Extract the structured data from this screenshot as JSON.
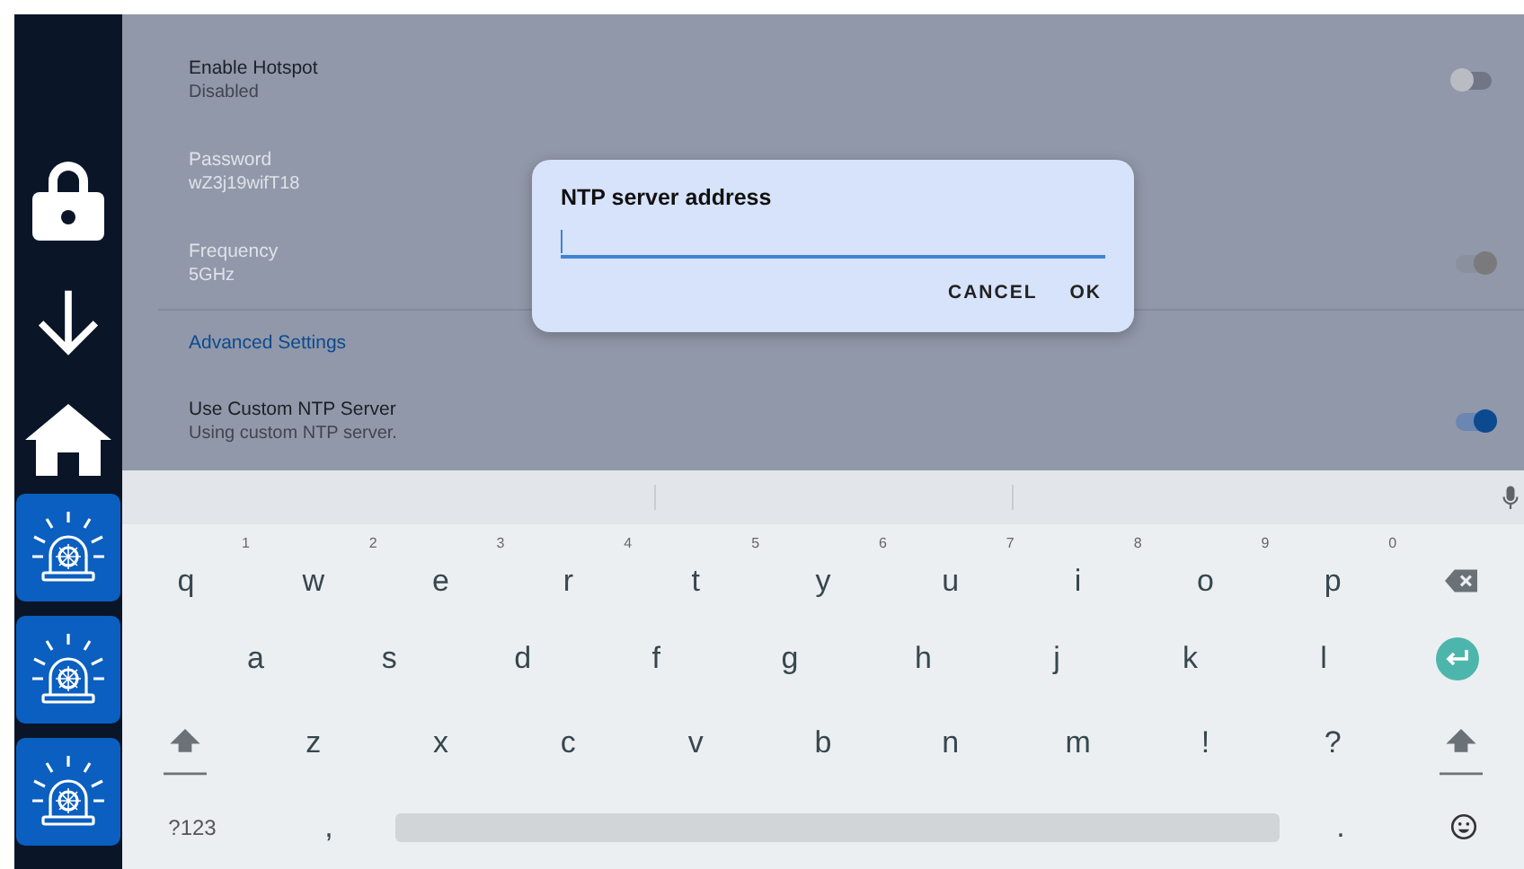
{
  "sidebar": [
    {
      "kind": "lock"
    },
    {
      "kind": "arrow"
    },
    {
      "kind": "home"
    },
    {
      "kind": "siren"
    },
    {
      "kind": "siren"
    },
    {
      "kind": "siren"
    }
  ],
  "settings": [
    {
      "kind": "toggle",
      "label": "Enable Hotspot",
      "value": "Disabled",
      "on": false,
      "disabled": false
    },
    {
      "kind": "text",
      "label": "Password",
      "value": "wZ3j19wifT18",
      "disabled": true
    },
    {
      "kind": "toggle",
      "label": "Frequency",
      "value": "5GHz",
      "on": true,
      "disabled": true
    },
    {
      "kind": "header",
      "label": "Advanced Settings"
    },
    {
      "kind": "toggle",
      "label": "Use Custom NTP Server",
      "value": "Using custom NTP server.",
      "on": true,
      "disabled": false
    }
  ],
  "dialog": {
    "title": "NTP server address",
    "buttons": [
      "CANCEL",
      "OK"
    ]
  },
  "keyboard": {
    "rows": [
      [
        {
          "kind": "char",
          "label": "q",
          "hint": "1"
        },
        {
          "kind": "char",
          "label": "w",
          "hint": "2"
        },
        {
          "kind": "char",
          "label": "e",
          "hint": "3"
        },
        {
          "kind": "char",
          "label": "r",
          "hint": "4"
        },
        {
          "kind": "char",
          "label": "t",
          "hint": "5"
        },
        {
          "kind": "char",
          "label": "y",
          "hint": "6"
        },
        {
          "kind": "char",
          "label": "u",
          "hint": "7"
        },
        {
          "kind": "char",
          "label": "i",
          "hint": "8"
        },
        {
          "kind": "char",
          "label": "o",
          "hint": "9"
        },
        {
          "kind": "char",
          "label": "p",
          "hint": "0"
        },
        {
          "kind": "backspace"
        }
      ],
      [
        {
          "kind": "gap"
        },
        {
          "kind": "char",
          "label": "a"
        },
        {
          "kind": "char",
          "label": "s"
        },
        {
          "kind": "char",
          "label": "d"
        },
        {
          "kind": "char",
          "label": "f"
        },
        {
          "kind": "char",
          "label": "g"
        },
        {
          "kind": "char",
          "label": "h"
        },
        {
          "kind": "char",
          "label": "j"
        },
        {
          "kind": "char",
          "label": "k"
        },
        {
          "kind": "char",
          "label": "l"
        },
        {
          "kind": "enter"
        }
      ],
      [
        {
          "kind": "shift"
        },
        {
          "kind": "char",
          "label": "z"
        },
        {
          "kind": "char",
          "label": "x"
        },
        {
          "kind": "char",
          "label": "c"
        },
        {
          "kind": "char",
          "label": "v"
        },
        {
          "kind": "char",
          "label": "b"
        },
        {
          "kind": "char",
          "label": "n"
        },
        {
          "kind": "char",
          "label": "m"
        },
        {
          "kind": "char",
          "label": "!"
        },
        {
          "kind": "char",
          "label": "?"
        },
        {
          "kind": "shift"
        }
      ]
    ],
    "bottom_bar": [
      {
        "kind": "symbols",
        "label": "?123"
      },
      {
        "kind": "char",
        "label": ","
      },
      {
        "kind": "space"
      },
      {
        "kind": "char",
        "label": "."
      },
      {
        "kind": "emoji"
      }
    ]
  }
}
